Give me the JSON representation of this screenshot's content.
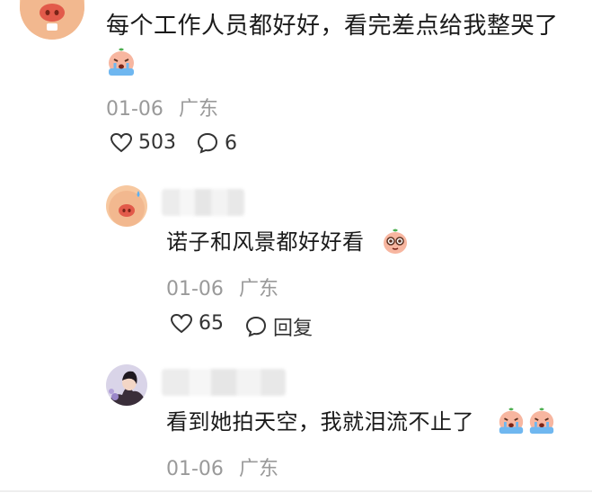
{
  "comments": [
    {
      "text": "每个工作人员都好好，看完差点给我整哭了",
      "date": "01-06",
      "location": "广东",
      "likes": "503",
      "replies": "6"
    }
  ],
  "replies": [
    {
      "text": "诺子和风景都好好看",
      "date": "01-06",
      "location": "广东",
      "likes": "65",
      "reply_label": "回复"
    },
    {
      "text": "看到她拍天空，我就泪流不止了",
      "date": "01-06",
      "location": "广东"
    }
  ],
  "icons": {
    "like": "heart-outline-icon",
    "comment": "speech-bubble-icon",
    "crying_emoji": "crying-face-emoji",
    "teary_emoji": "teary-eyed-face-emoji"
  }
}
